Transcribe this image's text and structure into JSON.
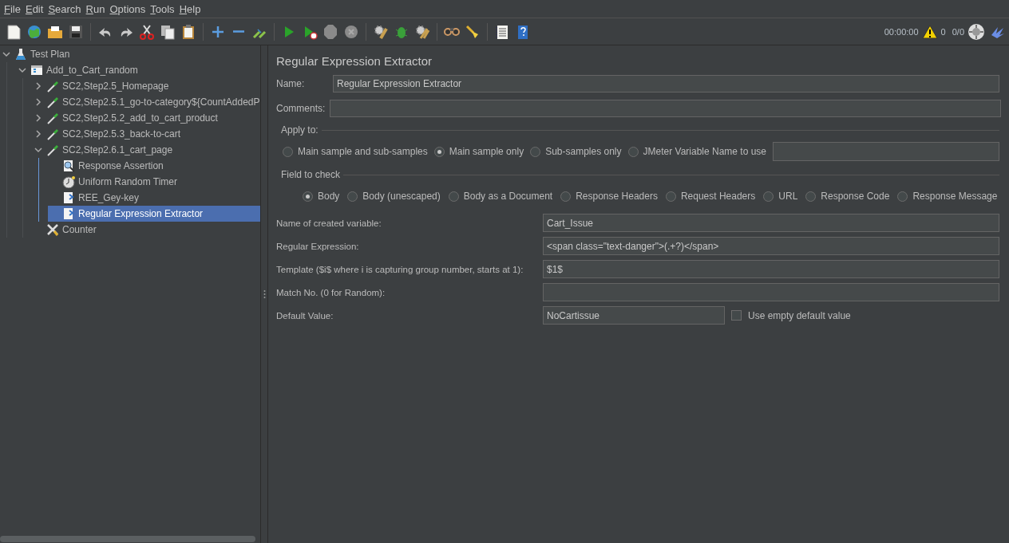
{
  "menu": [
    "File",
    "Edit",
    "Search",
    "Run",
    "Options",
    "Tools",
    "Help"
  ],
  "status": {
    "elapsed": "00:00:00",
    "warnings": "0",
    "threads": "0/0"
  },
  "tree": [
    {
      "label": "Test Plan",
      "kind": "test-plan",
      "expanded": true,
      "selected": false,
      "children": [
        {
          "label": "Add_to_Cart_random",
          "kind": "thread-group",
          "expanded": true,
          "selected": false,
          "children": [
            {
              "label": "SC2,Step2.5_Homepage",
              "kind": "sampler",
              "expanded": false,
              "selected": false
            },
            {
              "label": "SC2,Step2.5.1_go-to-category${CountAddedP",
              "kind": "sampler",
              "expanded": false,
              "selected": false
            },
            {
              "label": "SC2,Step2.5.2_add_to_cart_product",
              "kind": "sampler",
              "expanded": false,
              "selected": false
            },
            {
              "label": "SC2,Step2.5.3_back-to-cart",
              "kind": "sampler",
              "expanded": false,
              "selected": false
            },
            {
              "label": "SC2,Step2.6.1_cart_page",
              "kind": "sampler",
              "expanded": true,
              "selected": false,
              "children": [
                {
                  "label": "Response Assertion",
                  "kind": "assertion",
                  "selected": false
                },
                {
                  "label": "Uniform Random Timer",
                  "kind": "timer",
                  "selected": false
                },
                {
                  "label": "REE_Gey-key",
                  "kind": "extractor",
                  "selected": false
                },
                {
                  "label": "Regular Expression Extractor",
                  "kind": "extractor",
                  "selected": true
                }
              ]
            },
            {
              "label": "Counter",
              "kind": "config",
              "selected": false
            }
          ]
        }
      ]
    }
  ],
  "panel": {
    "title": "Regular Expression Extractor",
    "name_label": "Name:",
    "name_value": "Regular Expression Extractor",
    "comments_label": "Comments:",
    "apply_to": {
      "legend": "Apply to:",
      "options": [
        {
          "label": "Main sample and sub-samples",
          "selected": false
        },
        {
          "label": "Main sample only",
          "selected": true
        },
        {
          "label": "Sub-samples only",
          "selected": false
        },
        {
          "label": "JMeter Variable Name to use",
          "selected": false
        }
      ]
    },
    "field_to_check": {
      "legend": "Field to check",
      "options": [
        {
          "label": "Body",
          "selected": true
        },
        {
          "label": "Body (unescaped)",
          "selected": false
        },
        {
          "label": "Body as a Document",
          "selected": false
        },
        {
          "label": "Response Headers",
          "selected": false
        },
        {
          "label": "Request Headers",
          "selected": false
        },
        {
          "label": "URL",
          "selected": false
        },
        {
          "label": "Response Code",
          "selected": false
        },
        {
          "label": "Response Message",
          "selected": false
        }
      ]
    },
    "settings": [
      {
        "label": "Name of created variable:",
        "value": "Cart_Issue"
      },
      {
        "label": "Regular Expression:",
        "value": "<span class=\"text-danger\">(.+?)</span>"
      },
      {
        "label": "Template ($i$ where i is capturing group number, starts at 1):",
        "value": "$1$"
      },
      {
        "label": "Match No. (0 for Random):"
      }
    ],
    "default_value": {
      "label": "Default Value:",
      "value": "NoCartissue"
    },
    "use_empty": {
      "label": "Use empty default value",
      "checked": false
    }
  }
}
